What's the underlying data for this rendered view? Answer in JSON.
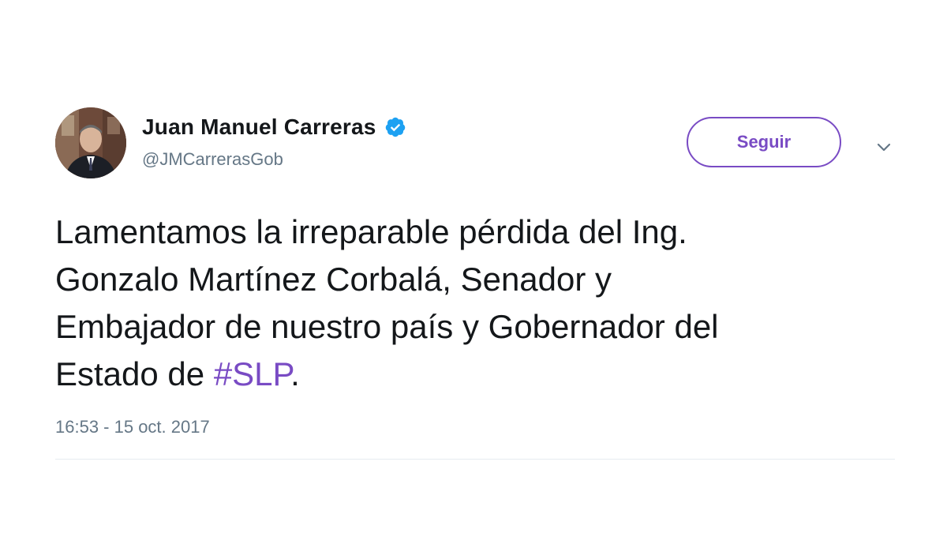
{
  "author": {
    "display_name": "Juan Manuel Carreras",
    "handle": "@JMCarrerasGob",
    "verified_icon": "verified-badge-icon",
    "avatar_icon": "profile-photo"
  },
  "actions": {
    "follow_label": "Seguir",
    "menu_icon": "chevron-down-icon"
  },
  "tweet": {
    "line1": "Lamentamos la irreparable pérdida del Ing.",
    "line2": "Gonzalo Martínez Corbalá, Senador y",
    "line3": "Embajador de nuestro país y Gobernador del",
    "line4_prefix": "Estado de ",
    "hashtag": "#SLP",
    "line4_suffix": ".",
    "timestamp": "16:53 - 15 oct. 2017"
  },
  "colors": {
    "accent": "#794bc4",
    "verified": "#1da1f2",
    "text": "#14171a",
    "secondary": "#657786"
  }
}
